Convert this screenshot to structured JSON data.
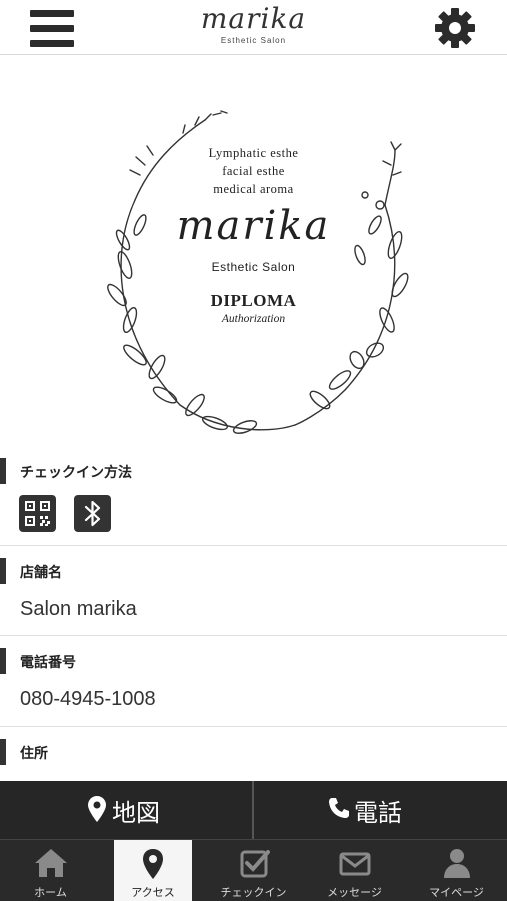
{
  "header": {
    "logo_script": "marika",
    "logo_sub": "Esthetic Salon"
  },
  "hero": {
    "line1": "Lymphatic esthe",
    "line2": "facial esthe",
    "line3": "medical aroma",
    "script": "marika",
    "sub": "Esthetic Salon",
    "diploma": "DIPLOMA",
    "authorization": "Authorization"
  },
  "sections": {
    "checkin": {
      "label": "チェックイン方法"
    },
    "store": {
      "label": "店舗名",
      "value": "Salon marika"
    },
    "phone": {
      "label": "電話番号",
      "value": "080-4945-1008"
    },
    "address": {
      "label": "住所"
    }
  },
  "actions": {
    "map": "地図",
    "call": "電話"
  },
  "tabs": [
    {
      "label": "ホーム",
      "icon": "home-icon"
    },
    {
      "label": "アクセス",
      "icon": "map-pin-icon"
    },
    {
      "label": "チェックイン",
      "icon": "checkin-icon"
    },
    {
      "label": "メッセージ",
      "icon": "envelope-icon"
    },
    {
      "label": "マイページ",
      "icon": "user-icon"
    }
  ],
  "colors": {
    "dark": "#262626",
    "tab_active_bg": "#f5f5f5",
    "section_bar": "#333333"
  }
}
